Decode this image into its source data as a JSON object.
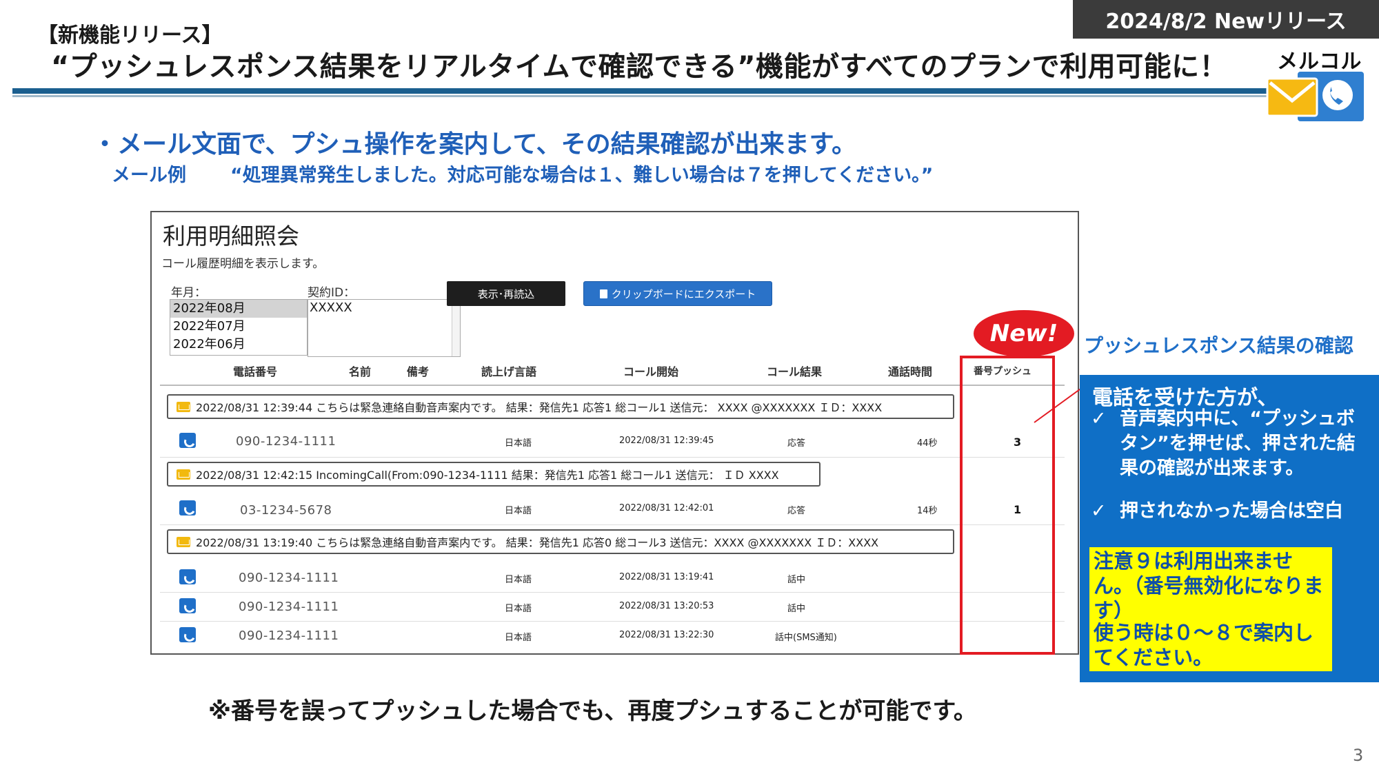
{
  "header": {
    "date_badge": "2024/8/2  Newリリース",
    "release_tag": "【新機能リリース】",
    "headline": "“プッシュレスポンス結果をリアルタイムで確認できる”機能がすべてのプランで利用可能に！",
    "brand_name": "メルコル"
  },
  "intro": {
    "bullet": "・メール文面で、プシュ操作を案内して、その結果確認が出来ます。",
    "mail_example_label": "メール例",
    "mail_example_text": "“処理異常発生しました。対応可能な場合は１、難しい場合は７を押してください。”"
  },
  "screen": {
    "title": "利用明細照会",
    "description": "コール履歴明細を表示します。",
    "month_label": "年月：",
    "contract_label": "契約ID：",
    "months": [
      "2022年08月",
      "2022年07月",
      "2022年06月"
    ],
    "contract_value": "XXXXX",
    "show_button": "表示･再読込",
    "export_button": "クリップボードにエクスポート",
    "columns": [
      "電話番号",
      "名前",
      "備考",
      "読上げ言語",
      "コール開始",
      "コール結果",
      "通話時間",
      "番号プッシュ"
    ],
    "groups": [
      {
        "text": "2022/08/31 12:39:44  こちらは緊急連絡自動音声案内です。  結果：発信先1 応答1 総コール1  送信元：  XXXX @XXXXXXX   ＩＤ：XXXX"
      },
      {
        "text": "2022/08/31 12:42:15  IncomingCall(From:090-1234-1111 結果：発信先1 応答1 総コール1  送信元：  ＩＤ XXXX"
      },
      {
        "text": "2022/08/31 13:19:40  こちらは緊急連絡自動音声案内です。  結果：発信先1 応答0 総コール3  送信元：XXXX @XXXXXXX   ＩＤ：XXXX"
      }
    ],
    "rows": [
      {
        "phone": "090-1234-1111",
        "lang": "日本語",
        "start": "2022/08/31 12:39:45",
        "result": "応答",
        "duration": "44秒",
        "push": "3"
      },
      {
        "phone": "03-1234-5678",
        "lang": "日本語",
        "start": "2022/08/31 12:42:01",
        "result": "応答",
        "duration": "14秒",
        "push": "1"
      },
      {
        "phone": "090-1234-1111",
        "lang": "日本語",
        "start": "2022/08/31 13:19:41",
        "result": "話中",
        "duration": "",
        "push": ""
      },
      {
        "phone": "090-1234-1111",
        "lang": "日本語",
        "start": "2022/08/31 13:20:53",
        "result": "話中",
        "duration": "",
        "push": ""
      },
      {
        "phone": "090-1234-1111",
        "lang": "日本語",
        "start": "2022/08/31 13:22:30",
        "result": "話中(SMS通知)",
        "duration": "",
        "push": ""
      }
    ]
  },
  "new_badge": "New!",
  "side": {
    "confirm_label": "プッシュレスポンス結果の確認",
    "intro": "電話を受けた方が、",
    "items": [
      "音声案内中に、“プッシュボタン”を押せば、押された結果の確認が出来ます。",
      "押されなかった場合は空白"
    ],
    "check_mark": "✓",
    "warn1": "注意９は利用出来ません。（番号無効化になります）",
    "warn2": "使う時は０～８で案内してください。"
  },
  "footer": {
    "note": "※番号を誤ってプッシュした場合でも、再度プシュすることが可能です。",
    "page_number": "3"
  },
  "colors": {
    "accent_blue": "#1f5fb8",
    "info_blue": "#0f6fc6",
    "highlight_red": "#e31b23",
    "header_line": "#1b5f8f",
    "warn_yellow": "#ffff00"
  }
}
